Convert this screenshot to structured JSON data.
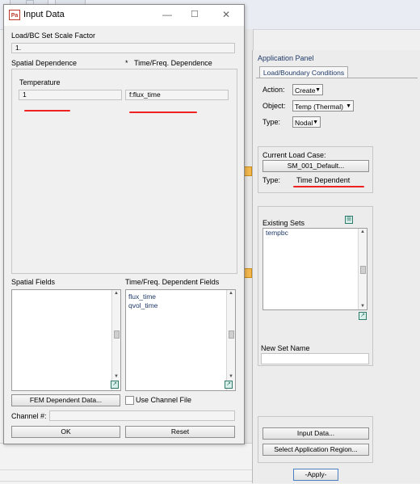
{
  "dialog": {
    "title": "Input Data",
    "app_icon": "Pa",
    "scale_factor_label": "Load/BC Set Scale Factor",
    "scale_factor_value": "1.",
    "spatial_dependence_label": "Spatial Dependence",
    "time_dependence_marker": "*",
    "time_dependence_label": "Time/Freq. Dependence",
    "temperature_label": "Temperature",
    "temperature_value": "1",
    "time_value": "f:flux_time",
    "spatial_fields_label": "Spatial Fields",
    "time_fields_label": "Time/Freq. Dependent Fields",
    "time_fields": [
      "flux_time",
      "qvol_time"
    ],
    "fem_button": "FEM Dependent Data...",
    "use_channel_label": "Use Channel File",
    "channel_label": "Channel #:",
    "ok_button": "OK",
    "reset_button": "Reset"
  },
  "panel": {
    "title": "Application Panel",
    "tab": "Load/Boundary Conditions",
    "action_label": "Action:",
    "action_value": "Create",
    "object_label": "Object:",
    "object_value": "Temp (Thermal)",
    "type_label": "Type:",
    "type_value": "Nodal",
    "load_case_label": "Current Load Case:",
    "load_case_value": "SM_001_Default...",
    "lc_type_label": "Type:",
    "lc_type_value": "Time Dependent",
    "existing_sets_label": "Existing Sets",
    "existing_sets": [
      "tempbc"
    ],
    "new_set_label": "New Set Name",
    "input_data_button": "Input Data...",
    "select_region_button": "Select Application Region...",
    "apply_button": "-Apply-"
  },
  "icons": {
    "window_minimize": "minimize-icon",
    "window_maximize": "maximize-icon",
    "window_close": "close-icon",
    "list_action": "list-action-icon",
    "dropdown": "chevron-down-icon"
  },
  "colors": {
    "annotation_underline": "#e22222",
    "list_text": "#1f3a68",
    "accent_orange": "#f2b64e"
  }
}
